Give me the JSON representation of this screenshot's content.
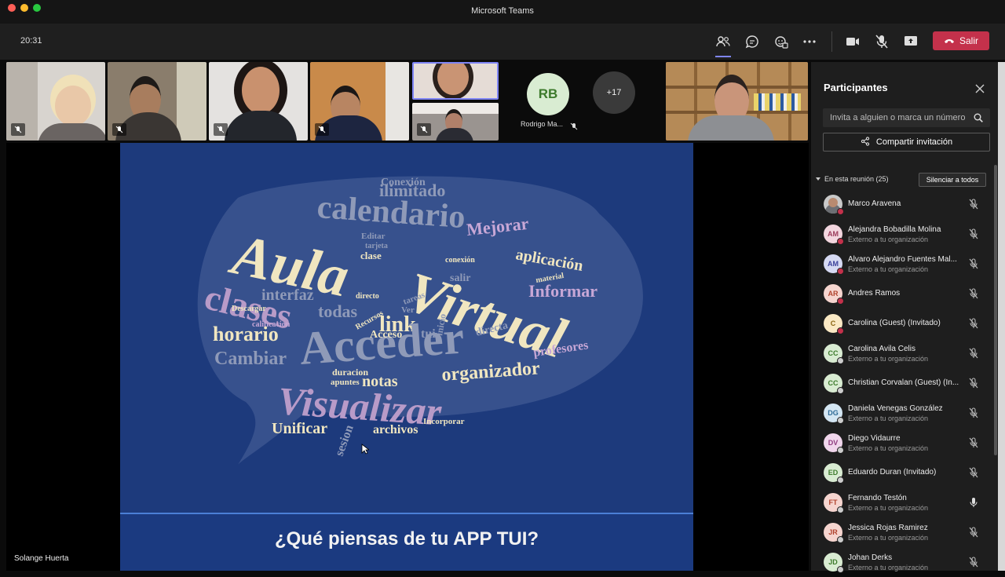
{
  "window": {
    "title": "Microsoft Teams"
  },
  "toolbar": {
    "time": "20:31",
    "icons": [
      "participants-icon",
      "chat-icon",
      "reactions-icon",
      "more-icon",
      "camera-icon",
      "mic-off-icon",
      "share-icon"
    ],
    "leave_label": "Salir"
  },
  "video": {
    "rb_initials": "RB",
    "rb_name": "Rodrigo Ma...",
    "more_count": "+17"
  },
  "slide": {
    "question": "¿Qué piensas de tu APP TUI?",
    "words": [
      "Aula",
      "Virtual",
      "Acceder",
      "Visualizar",
      "calendario",
      "ilimitado",
      "Mejorar",
      "aplicación",
      "clases",
      "interfaz",
      "todas",
      "link",
      "horario",
      "Informar",
      "Cambiar",
      "organizador",
      "notas",
      "apuntes",
      "duracion",
      "archivos",
      "Unificar",
      "sesion",
      "Acceso",
      "Conexión",
      "directo",
      "clase",
      "profesores",
      "Descargar",
      "calificacion",
      "Incorporar",
      "Editar",
      "inicio",
      "conexión",
      "tarjeta",
      "directa",
      "Recursos",
      "material",
      "tareas",
      "salir",
      "tui",
      "Ver"
    ],
    "presenter": "Solange Huerta"
  },
  "panel": {
    "title": "Participantes",
    "invite_placeholder": "Invita a alguien o marca un número",
    "share_label": "Compartir invitación",
    "section_label": "En esta reunión (25)",
    "mute_all_label": "Silenciar a todos",
    "participants": [
      {
        "name": "Marco Aravena",
        "sub": "",
        "initials": "",
        "photo": true,
        "avatar_bg": "#c9c9c9",
        "avatar_fg": "#333",
        "status": "#c4314b",
        "mic": "off"
      },
      {
        "name": "Alejandra Bobadilla Molina",
        "sub": "Externo a tu organización",
        "initials": "AM",
        "avatar_bg": "#f3d6df",
        "avatar_fg": "#9a3a5a",
        "status": "#c4314b",
        "mic": "off"
      },
      {
        "name": "Alvaro Alejandro Fuentes Mal...",
        "sub": "Externo a tu organización",
        "initials": "AM",
        "avatar_bg": "#d6d9f3",
        "avatar_fg": "#3a3f9a",
        "status": "#c4314b",
        "mic": "off"
      },
      {
        "name": "Andres Ramos",
        "sub": "",
        "initials": "AR",
        "avatar_bg": "#f6d5cf",
        "avatar_fg": "#b0432d",
        "status": "#c4314b",
        "mic": "off"
      },
      {
        "name": "Carolina (Guest) (Invitado)",
        "sub": "",
        "initials": "C",
        "avatar_bg": "#fbe9c4",
        "avatar_fg": "#8a6410",
        "status": "#c4314b",
        "mic": "off"
      },
      {
        "name": "Carolina Avila Celis",
        "sub": "Externo a tu organización",
        "initials": "CC",
        "avatar_bg": "#d9ecd2",
        "avatar_fg": "#3d7a2c",
        "status": "#cccccc",
        "mic": "off"
      },
      {
        "name": "Christian Corvalan (Guest) (In...",
        "sub": "",
        "initials": "CC",
        "avatar_bg": "#d9ecd2",
        "avatar_fg": "#3d7a2c",
        "status": "#cccccc",
        "mic": "off"
      },
      {
        "name": "Daniela Venegas González",
        "sub": "Externo a tu organización",
        "initials": "DG",
        "avatar_bg": "#d4e6f3",
        "avatar_fg": "#2e6a96",
        "status": "#cccccc",
        "mic": "off"
      },
      {
        "name": "Diego Vidaurre",
        "sub": "Externo a tu organización",
        "initials": "DV",
        "avatar_bg": "#f1d6ec",
        "avatar_fg": "#8e3a7e",
        "status": "#cccccc",
        "mic": "off"
      },
      {
        "name": "Eduardo Duran (Invitado)",
        "sub": "",
        "initials": "ED",
        "avatar_bg": "#d9ecd2",
        "avatar_fg": "#3d7a2c",
        "status": "#cccccc",
        "mic": "off"
      },
      {
        "name": "Fernando Testón",
        "sub": "Externo a tu organización",
        "initials": "FT",
        "avatar_bg": "#f6d5cf",
        "avatar_fg": "#b0432d",
        "status": "#cccccc",
        "mic": "on"
      },
      {
        "name": "Jessica Rojas Ramirez",
        "sub": "Externo a tu organización",
        "initials": "JR",
        "avatar_bg": "#f6d5cf",
        "avatar_fg": "#b0432d",
        "status": "#cccccc",
        "mic": "off"
      },
      {
        "name": "Johan Derks",
        "sub": "Externo a tu organización",
        "initials": "JD",
        "avatar_bg": "#d9ecd2",
        "avatar_fg": "#3d7a2c",
        "status": "#cccccc",
        "mic": "off"
      }
    ]
  }
}
